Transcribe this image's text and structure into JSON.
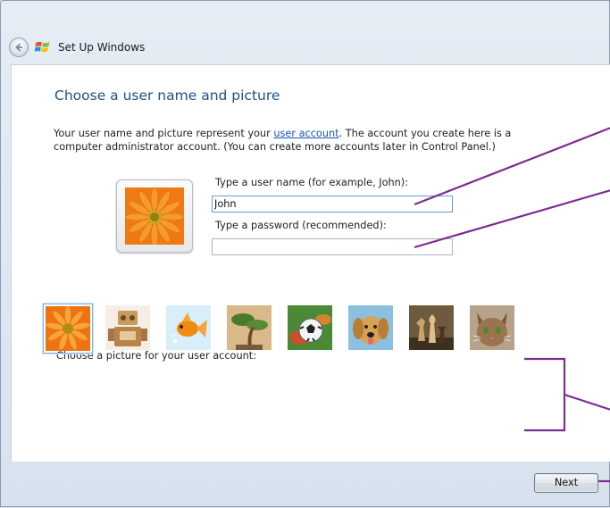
{
  "window": {
    "title": "Set Up Windows"
  },
  "page": {
    "heading": "Choose a user name and picture",
    "intro_before_link": "Your user name and picture represent your ",
    "intro_link": "user account",
    "intro_after_link": ". The account you create here is a computer administrator account. (You can create more accounts later in Control Panel.)"
  },
  "form": {
    "username_label": "Type a user name (for example, John):",
    "username_value": "John",
    "password_label": "Type a password (recommended):",
    "password_value": ""
  },
  "pictures": {
    "label": "Choose a picture for your user account:",
    "items": [
      {
        "name": "flower",
        "selected": true
      },
      {
        "name": "robot",
        "selected": false
      },
      {
        "name": "goldfish",
        "selected": false
      },
      {
        "name": "bonsai",
        "selected": false
      },
      {
        "name": "soccer-ball",
        "selected": false
      },
      {
        "name": "dog",
        "selected": false
      },
      {
        "name": "chess",
        "selected": false
      },
      {
        "name": "kitten",
        "selected": false
      }
    ]
  },
  "footer": {
    "next_label": "Next"
  },
  "colors": {
    "annotation": "#7b2d8e",
    "heading": "#1e4f8a",
    "link": "#1a55b0"
  }
}
